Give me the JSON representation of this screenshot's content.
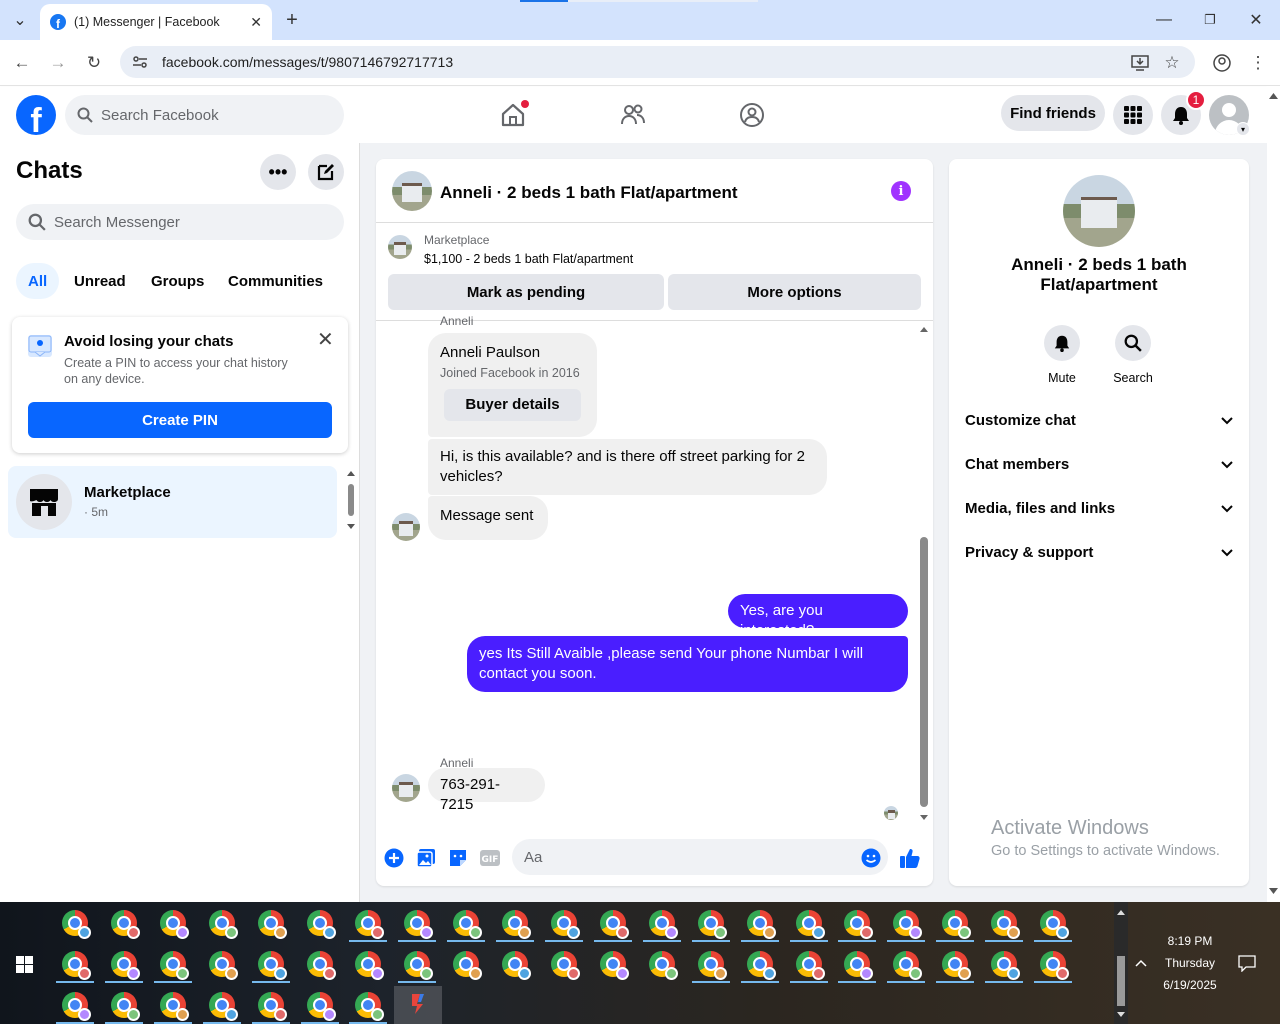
{
  "browser": {
    "tab_title": "(1) Messenger | Facebook",
    "url": "facebook.com/messages/t/9807146792717713"
  },
  "fb_header": {
    "search_placeholder": "Search Facebook",
    "find_friends": "Find friends",
    "notification_count": "1"
  },
  "sidebar": {
    "title": "Chats",
    "search_placeholder": "Search Messenger",
    "filters": [
      "All",
      "Unread",
      "Groups",
      "Communities"
    ],
    "pin_card": {
      "title": "Avoid losing your chats",
      "text": "Create a PIN to access your chat history on any device.",
      "button": "Create PIN"
    },
    "chats": [
      {
        "name": "Marketplace",
        "time": "· 5m"
      }
    ]
  },
  "conversation": {
    "title": "Anneli · 2 beds 1 bath Flat/apartment",
    "marketplace_label": "Marketplace",
    "listing": "$1,100 - 2 beds 1 bath Flat/apartment",
    "mark_pending": "Mark as pending",
    "more_options": "More options",
    "messages": {
      "sender_top": "Anneli",
      "card_name": "Anneli Paulson",
      "card_joined": "Joined Facebook in 2016",
      "buyer_details": "Buyer details",
      "m1": "Hi, is this available? and is there off street parking for 2 vehicles?",
      "m2": "Message sent",
      "m3": "Yes, are you interested?",
      "m4": "yes Its Still Avaible ,please send Your phone Numbar I will contact you soon.",
      "sender_bottom": "Anneli",
      "m5": "763-291-7215"
    },
    "composer_placeholder": "Aa"
  },
  "right_panel": {
    "name": "Anneli · 2 beds 1 bath Flat/apartment",
    "mute": "Mute",
    "search": "Search",
    "sections": [
      "Customize chat",
      "Chat members",
      "Media, files and links",
      "Privacy & support"
    ]
  },
  "watermark": {
    "line1": "Activate Windows",
    "line2": "Go to Settings to activate Windows."
  },
  "taskbar": {
    "time": "8:19 PM",
    "day": "Thursday",
    "date": "6/19/2025"
  },
  "colors": {
    "fb_blue": "#0866ff",
    "outgoing_bubble": "#4a1eff",
    "info_purple": "#a033ff",
    "badge_red": "#e41e3f"
  }
}
